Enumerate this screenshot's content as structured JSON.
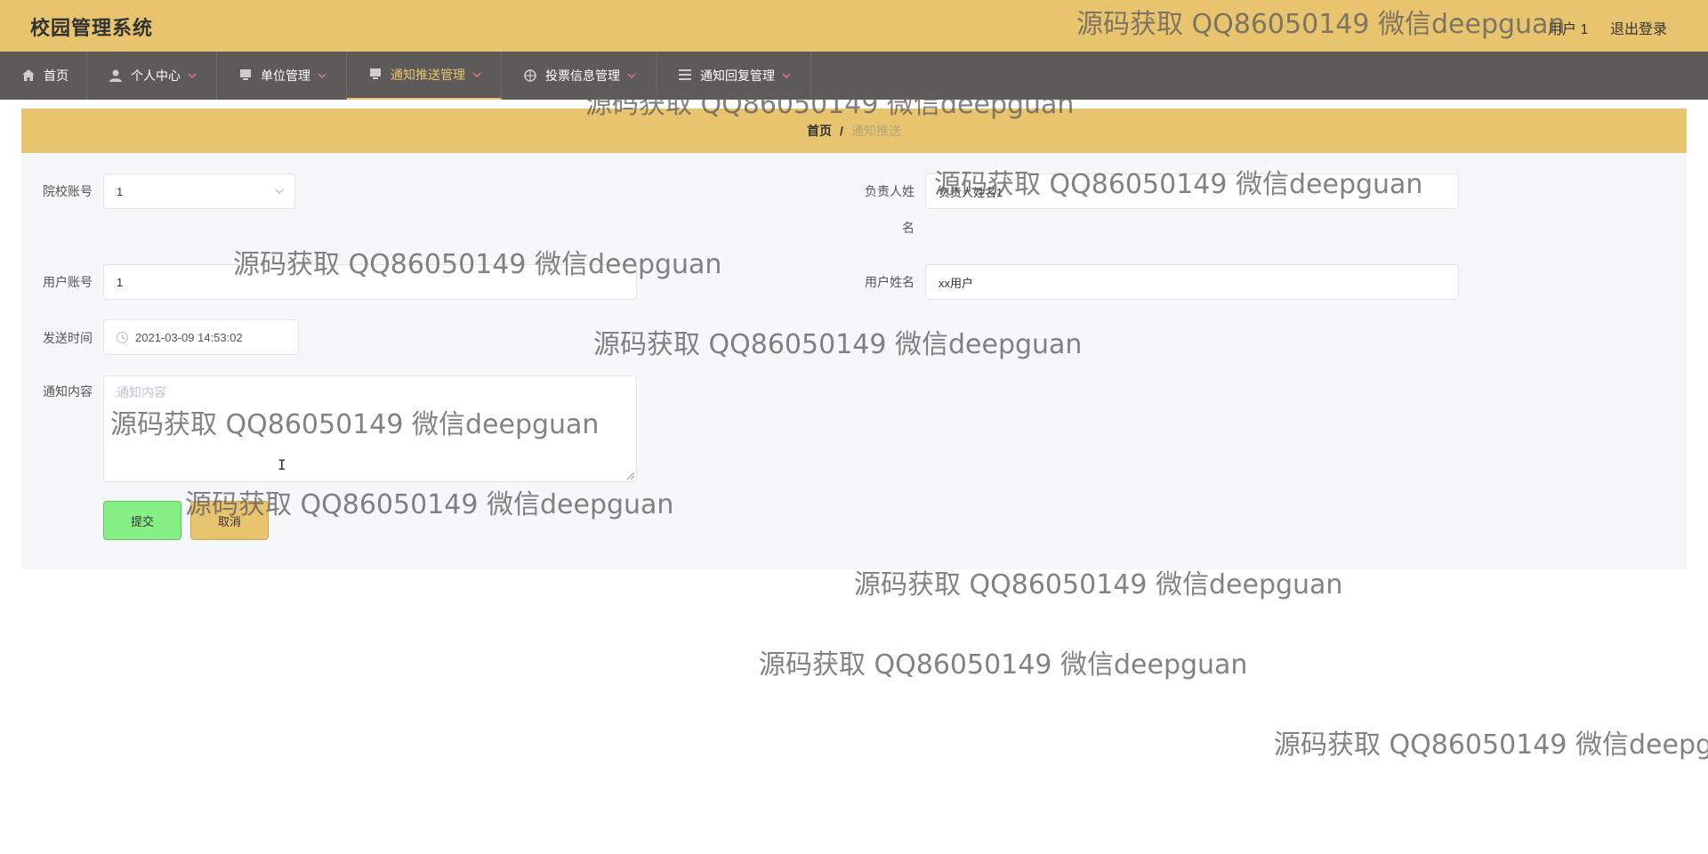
{
  "header": {
    "app_title": "校园管理系统",
    "user_label": "用户 1",
    "logout_label": "退出登录"
  },
  "nav": {
    "items": [
      {
        "label": "首页",
        "icon": "home-icon",
        "has_dropdown": false
      },
      {
        "label": "个人中心",
        "icon": "user-icon",
        "has_dropdown": true
      },
      {
        "label": "单位管理",
        "icon": "monitor-icon",
        "has_dropdown": true
      },
      {
        "label": "通知推送管理",
        "icon": "monitor-icon",
        "has_dropdown": true,
        "active": true
      },
      {
        "label": "投票信息管理",
        "icon": "target-icon",
        "has_dropdown": true
      },
      {
        "label": "通知回复管理",
        "icon": "list-icon",
        "has_dropdown": true
      }
    ]
  },
  "breadcrumb": {
    "home": "首页",
    "separator": "/",
    "current": "通知推送"
  },
  "form": {
    "school_account": {
      "label": "院校账号",
      "value": "1"
    },
    "leader_name": {
      "label_line1": "负责人姓",
      "label_line2": "名",
      "value": "负责人姓名1"
    },
    "user_account": {
      "label": "用户账号",
      "value": "1"
    },
    "user_name": {
      "label": "用户姓名",
      "value": "xx用户"
    },
    "send_time": {
      "label": "发送时间",
      "value": "2021-03-09 14:53:02"
    },
    "content": {
      "label": "通知内容",
      "placeholder": "通知内容"
    },
    "submit_label": "提交",
    "cancel_label": "取消"
  },
  "watermark": {
    "text": "源码获取 QQ86050149 微信deepguan",
    "text_cut": "源码获取 QQ86050149 微信deepgu"
  },
  "colors": {
    "header_bg": "#e8c46e",
    "nav_bg": "#5d5b59",
    "nav_active": "#e8c46e",
    "submit_bg": "#86ef86",
    "cancel_bg": "#e8c46e"
  }
}
